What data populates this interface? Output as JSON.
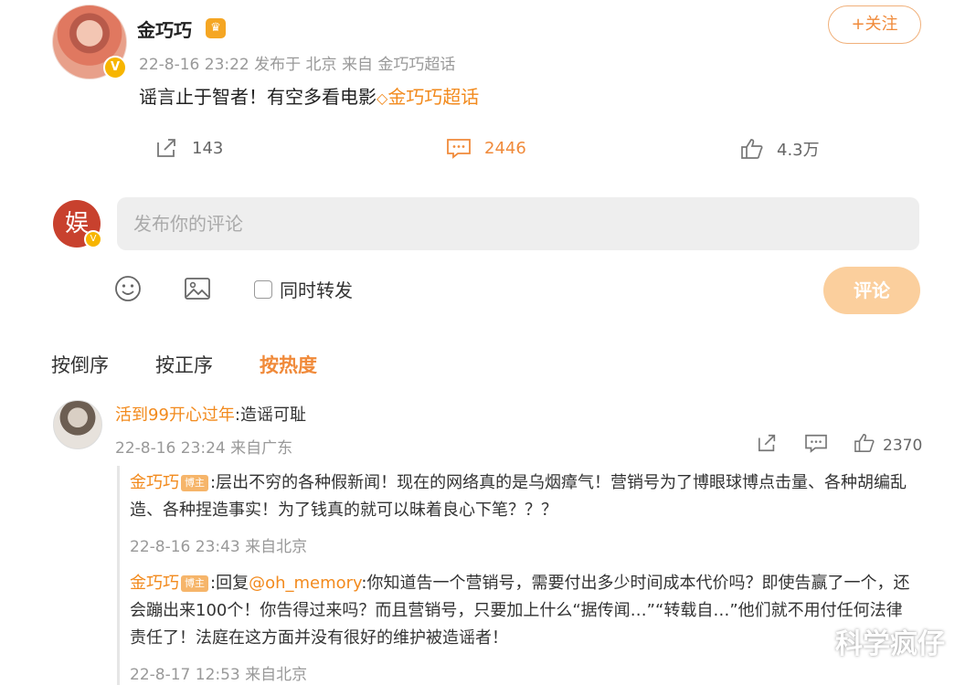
{
  "post": {
    "username": "金巧巧",
    "meta": "22-8-16 23:22 发布于 北京 来自 金巧巧超话",
    "text": "谣言止于智者！有空多看电影",
    "topic": "金巧巧超话",
    "follow_label": "+关注",
    "reposts": "143",
    "comments": "2446",
    "likes": "4.3万"
  },
  "composer": {
    "placeholder": "发布你的评论",
    "repost_label": "同时转发",
    "submit_label": "评论"
  },
  "sort_tabs": [
    "按倒序",
    "按正序",
    "按热度"
  ],
  "comment": {
    "name": "活到99开心过年",
    "text": ":造谣可耻",
    "meta": "22-8-16 23:24 来自广东",
    "likes": "2370"
  },
  "replies": [
    {
      "name": "金巧巧",
      "tag": "博主",
      "text": ":层出不穷的各种假新闻！现在的网络真的是乌烟瘴气！营销号为了博眼球博点击量、各种胡编乱造、各种捏造事实！为了钱真的就可以昧着良心下笔？？？",
      "meta": "22-8-16 23:43 来自北京"
    },
    {
      "name": "金巧巧",
      "tag": "博主",
      "prefix": ":回复",
      "mention": "@oh_memory",
      "text": ":你知道告一个营销号，需要付出多少时间成本代价吗？即使告赢了一个，还会蹦出来100个！你告得过来吗？而且营销号，只要加上什么“据传闻…”“转载自…”他们就不用付任何法律责任了！法庭在这方面并没有很好的维护被造谣者！",
      "meta": "22-8-17 12:53 来自北京"
    }
  ],
  "watermark": "科学疯仔",
  "colors": {
    "accent": "#f08a3a",
    "submit_bg": "#fbcf9d",
    "badge": "#f7b500"
  }
}
